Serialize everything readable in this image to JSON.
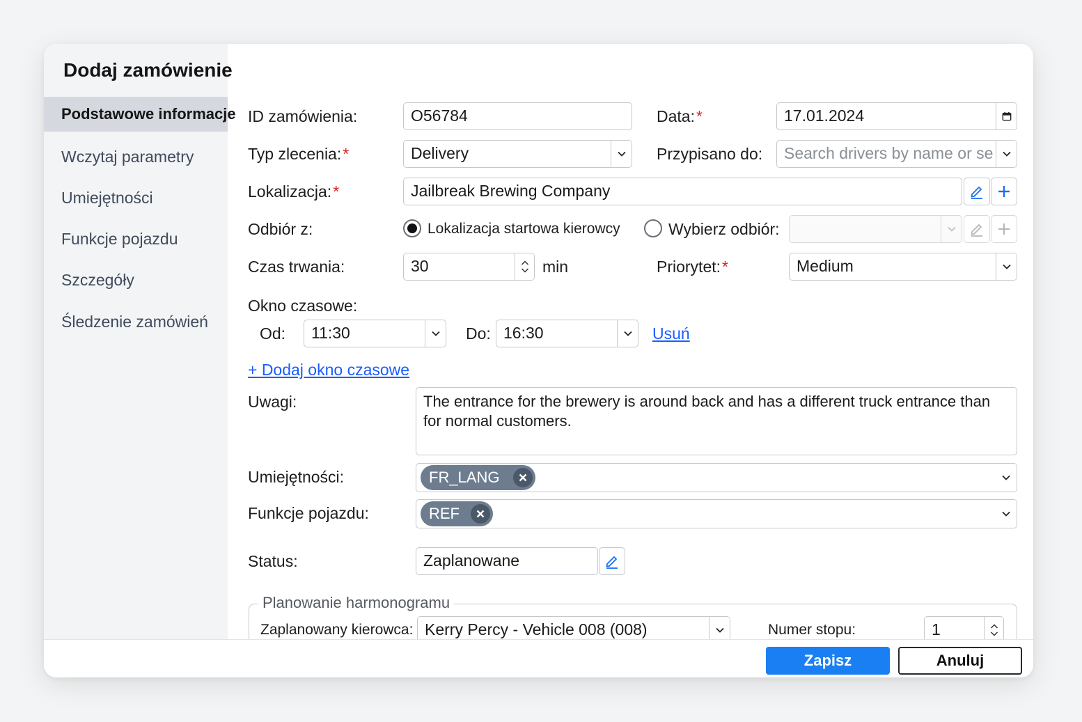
{
  "dialog": {
    "title": "Dodaj zamówienie"
  },
  "sidebar": {
    "items": [
      {
        "label": "Podstawowe informacje",
        "active": true
      },
      {
        "label": "Wczytaj parametry"
      },
      {
        "label": "Umiejętności"
      },
      {
        "label": "Funkcje pojazdu"
      },
      {
        "label": "Szczegóły"
      },
      {
        "label": "Śledzenie zamówień"
      }
    ]
  },
  "form": {
    "order_id": {
      "label": "ID zamówienia:",
      "value": "O56784"
    },
    "date": {
      "label": "Data:",
      "required_mark": "*",
      "value": "17.01.2024"
    },
    "order_type": {
      "label": "Typ zlecenia:",
      "required_mark": "*",
      "value": "Delivery"
    },
    "assigned_to": {
      "label": "Przypisano do:",
      "placeholder": "Search drivers by name or se"
    },
    "location": {
      "label": "Lokalizacja:",
      "required_mark": "*",
      "value": "Jailbreak Brewing Company"
    },
    "pickup": {
      "label": "Odbiór z:",
      "option_driver_start": "Lokalizacja startowa kierowcy",
      "option_choose": "Wybierz odbiór:",
      "selected": "driver_start"
    },
    "duration": {
      "label": "Czas trwania:",
      "value": "30",
      "unit": "min"
    },
    "priority": {
      "label": "Priorytet:",
      "required_mark": "*",
      "value": "Medium"
    },
    "time_window": {
      "label": "Okno czasowe:",
      "from_label": "Od:",
      "from_value": "11:30",
      "to_label": "Do:",
      "to_value": "16:30",
      "remove_link": "Usuń",
      "add_link": "+ Dodaj okno czasowe"
    },
    "notes": {
      "label": "Uwagi:",
      "value": "The entrance for the brewery is around back and has a different truck entrance than for normal customers."
    },
    "skills": {
      "label": "Umiejętności:",
      "chips": [
        "FR_LANG"
      ]
    },
    "vehicle_features": {
      "label": "Funkcje pojazdu:",
      "chips": [
        "REF"
      ]
    },
    "status": {
      "label": "Status:",
      "value": "Zaplanowane"
    },
    "scheduling": {
      "legend": "Planowanie harmonogramu",
      "driver_label": "Zaplanowany kierowca:",
      "driver_value": "Kerry Percy - Vehicle 008 (008)",
      "stop_label": "Numer stopu:",
      "stop_value": "1"
    }
  },
  "footer": {
    "save_label": "Zapisz",
    "cancel_label": "Anuluj"
  },
  "colors": {
    "accent": "#1a7ff2",
    "link": "#1a5cff",
    "required": "#e02020",
    "chip": "#6d7d8f"
  }
}
